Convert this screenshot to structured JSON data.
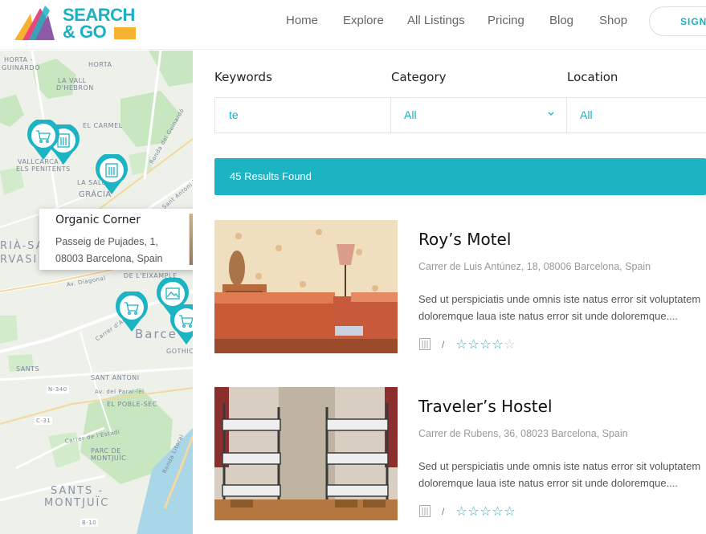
{
  "header": {
    "logo_line1": "SEARCH",
    "logo_line2": "& GO",
    "nav": [
      "Home",
      "Explore",
      "All Listings",
      "Pricing",
      "Blog",
      "Shop"
    ],
    "sign_label": "SIGN"
  },
  "map": {
    "labels": {
      "horta": "HORTA -",
      "guinardo": "GUINARDÓ",
      "horta2": "HORTA",
      "la_vall": "LA VALL",
      "dhebron": "D'HEBRON",
      "el_carmel": "EL CARMEL",
      "vallcarca": "VALLCARCA I",
      "penitents": "ELS PENITENTS",
      "la_salut": "LA SALUT",
      "gracia": "GRÀCIA",
      "ronda_guinardo": "Ronda del Guinardó",
      "sant_antoni_maria": "Sant Antoni M. Claret",
      "sarria": "RIÀ-SA",
      "vasi": "RVASI",
      "eixample": "DE L'EIXAMPLE",
      "av_diagonal": "Av. Diagonal",
      "barcelona": "Barce",
      "gothic": "GOTHIC",
      "carrer_arago": "Carrer d'Aragó",
      "sants": "SANTS",
      "sant_antoni": "SANT ANTONI",
      "n340": "N-340",
      "av_parallel": "Av. del Paral·lel",
      "el_poble_sec": "EL POBLE-SEC",
      "c31": "C-31",
      "carrer_estadi": "Carrer de l'Estadi",
      "parc_montjuic": "PARC DE",
      "montjuic": "MONTJUÏC",
      "ronda_litoral": "Ronda Litoral",
      "sants_montjuic1": "SANTS -",
      "sants_montjuic2": "MONTJUÏC",
      "b10": "B-10"
    },
    "popup": {
      "title": "Organic Corner",
      "address": "Passeig de Pujades, 1, 08003 Barcelona, Spain"
    },
    "pin_icons": [
      "shopping-cart-icon",
      "building-icon",
      "building-icon",
      "shopping-cart-icon",
      "image-icon",
      "shopping-cart-icon"
    ]
  },
  "search": {
    "keywords_label": "Keywords",
    "keywords_value": "te",
    "category_label": "Category",
    "category_value": "All",
    "location_label": "Location",
    "location_value": "All"
  },
  "results": {
    "count_text": "45 Results Found"
  },
  "listings": [
    {
      "title": "Roy’s Motel",
      "address": "Carrer de Luis Antúnez, 18, 08006 Barcelona, Spain",
      "desc_line1": "Sed ut perspiciatis unde omnis iste natus error sit voluptatem",
      "desc_line2": "doloremque laua iste natus error sit unde doloremque....",
      "separator": "/",
      "rating": 4,
      "rating_max": 5,
      "category_icon": "building-icon"
    },
    {
      "title": "Traveler’s Hostel",
      "address": "Carrer de Rubens, 36, 08023 Barcelona, Spain",
      "desc_line1": "Sed ut perspiciatis unde omnis iste natus error sit voluptatem",
      "desc_line2": "doloremque laua iste natus error sit unde doloremque....",
      "separator": "/",
      "rating": 5,
      "rating_max": 5,
      "category_icon": "building-icon"
    }
  ],
  "colors": {
    "accent": "#1cb3c3",
    "logo_yellow": "#f7b131",
    "logo_pink": "#e8467c",
    "logo_purple": "#8e5aa8"
  }
}
